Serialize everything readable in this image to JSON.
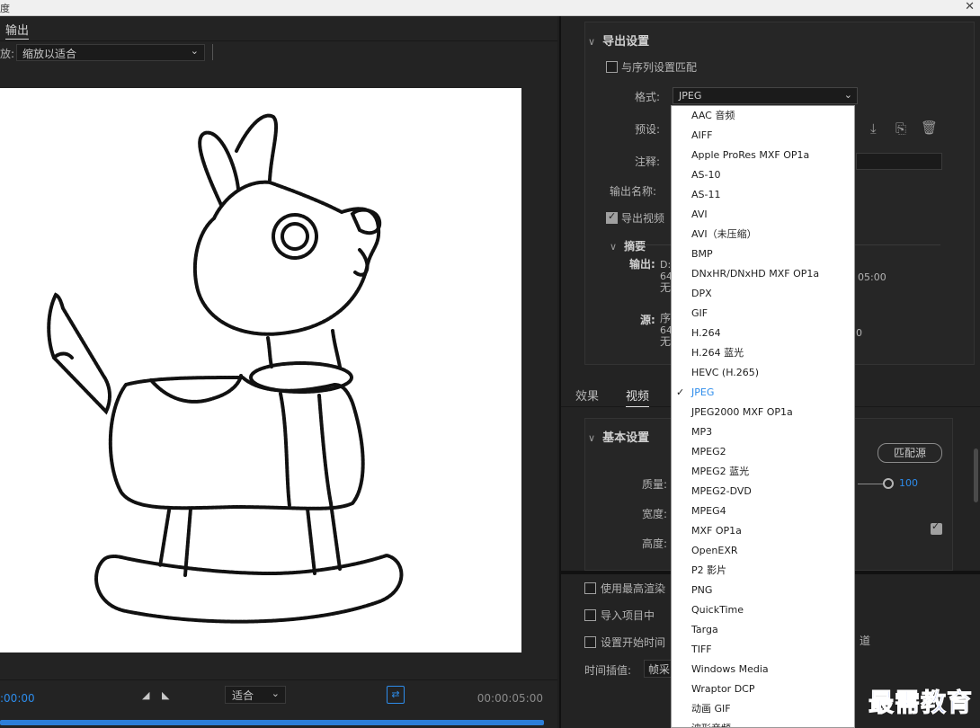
{
  "window": {
    "title_fragment": "度",
    "close_glyph": "✕"
  },
  "left_panel": {
    "tab_label": "输出",
    "source_scaling_label": "放:",
    "source_scaling_value": "缩放以适合",
    "timecode_in": ":00:00",
    "fit_label": "适合",
    "timecode_out": "00:00:05:00",
    "loop_icon": "⇄"
  },
  "export_settings": {
    "section_title": "导出设置",
    "match_sequence_label": "与序列设置匹配",
    "format_label": "格式:",
    "format_value": "JPEG",
    "preset_label": "预设:",
    "comments_label": "注释:",
    "output_name_label": "输出名称:",
    "export_video_label": "导出视频",
    "summary_title": "摘要",
    "output_key": "输出:",
    "output_lines": [
      "D:\\",
      "64",
      "无"
    ],
    "output_time": "05:00",
    "source_key": "源:",
    "source_lines": [
      "序",
      "64",
      "无"
    ],
    "source_time": "0"
  },
  "tabs": [
    {
      "label": "效果"
    },
    {
      "label": "视频"
    }
  ],
  "basic_settings": {
    "section_title": "基本设置",
    "match_source_label": "匹配源",
    "quality_label": "质量:",
    "quality_value": "100",
    "width_label": "宽度:",
    "height_label": "高度:"
  },
  "bottom_options": {
    "use_max_render_label": "使用最高渲染",
    "import_into_project_label": "导入项目中",
    "set_start_time_label": "设置开始时间",
    "channel_fragment": "道",
    "time_interp_label": "时间插值:",
    "time_interp_value": "帧采"
  },
  "format_dropdown": {
    "selected": "JPEG",
    "items": [
      "AAC 音频",
      "AIFF",
      "Apple ProRes MXF OP1a",
      "AS-10",
      "AS-11",
      "AVI",
      "AVI（未压缩）",
      "BMP",
      "DNxHR/DNxHD MXF OP1a",
      "DPX",
      "GIF",
      "H.264",
      "H.264 蓝光",
      "HEVC (H.265)",
      "JPEG",
      "JPEG2000 MXF OP1a",
      "MP3",
      "MPEG2",
      "MPEG2 蓝光",
      "MPEG2-DVD",
      "MPEG4",
      "MXF OP1a",
      "OpenEXR",
      "P2 影片",
      "PNG",
      "QuickTime",
      "Targa",
      "TIFF",
      "Windows Media",
      "Wraptor DCP",
      "动画 GIF",
      "波形音频"
    ]
  },
  "watermark": "最需教育",
  "colors": {
    "accent": "#2d8ceb",
    "panel": "#232323",
    "watermark": "#1d3fd0"
  },
  "icons": [
    "chevron-down-icon",
    "checkbox-icon",
    "save-preset-icon",
    "import-preset-icon",
    "trash-icon",
    "loop-icon",
    "checkmark-icon"
  ]
}
